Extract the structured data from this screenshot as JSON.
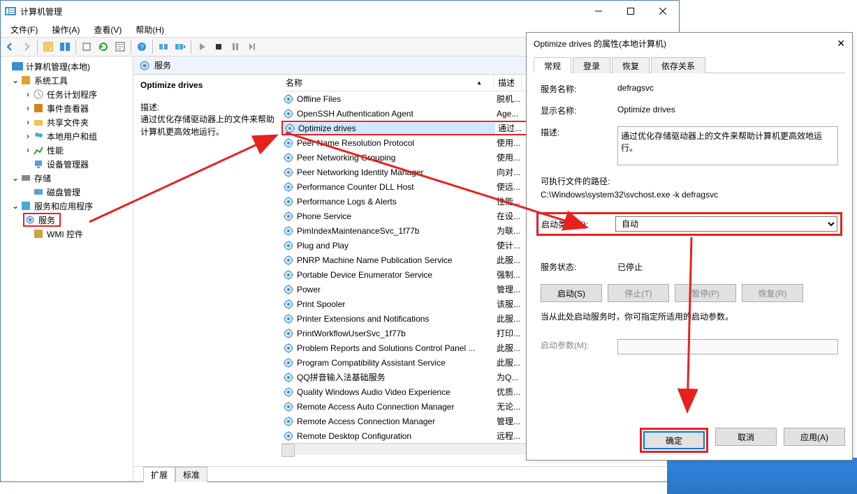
{
  "window": {
    "title": "计算机管理",
    "menu": [
      "文件(F)",
      "操作(A)",
      "查看(V)",
      "帮助(H)"
    ]
  },
  "tree": {
    "root": "计算机管理(本地)",
    "n1": "系统工具",
    "n1a": "任务计划程序",
    "n1b": "事件查看器",
    "n1c": "共享文件夹",
    "n1d": "本地用户和组",
    "n1e": "性能",
    "n1f": "设备管理器",
    "n2": "存储",
    "n2a": "磁盘管理",
    "n3": "服务和应用程序",
    "n3a": "服务",
    "n3b": "WMI 控件"
  },
  "services_pane": {
    "header": "服务",
    "selected_name": "Optimize drives",
    "desc_label": "描述:",
    "desc_text": "通过优化存储驱动器上的文件来帮助计算机更高效地运行。",
    "col_name": "名称",
    "col_desc": "描述",
    "tab_ext": "扩展",
    "tab_std": "标准"
  },
  "rows": [
    {
      "name": "Offline Files",
      "desc": "脱机..."
    },
    {
      "name": "OpenSSH Authentication Agent",
      "desc": "Age..."
    },
    {
      "name": "Optimize drives",
      "desc": "通过...",
      "selected": true
    },
    {
      "name": "Peer Name Resolution Protocol",
      "desc": "使用..."
    },
    {
      "name": "Peer Networking Grouping",
      "desc": "使用..."
    },
    {
      "name": "Peer Networking Identity Manager",
      "desc": "向对..."
    },
    {
      "name": "Performance Counter DLL Host",
      "desc": "使远..."
    },
    {
      "name": "Performance Logs & Alerts",
      "desc": "性能..."
    },
    {
      "name": "Phone Service",
      "desc": "在设..."
    },
    {
      "name": "PimIndexMaintenanceSvc_1f77b",
      "desc": "为联..."
    },
    {
      "name": "Plug and Play",
      "desc": "使计..."
    },
    {
      "name": "PNRP Machine Name Publication Service",
      "desc": "此服..."
    },
    {
      "name": "Portable Device Enumerator Service",
      "desc": "强制..."
    },
    {
      "name": "Power",
      "desc": "管理..."
    },
    {
      "name": "Print Spooler",
      "desc": "该服..."
    },
    {
      "name": "Printer Extensions and Notifications",
      "desc": "此服..."
    },
    {
      "name": "PrintWorkflowUserSvc_1f77b",
      "desc": "打印..."
    },
    {
      "name": "Problem Reports and Solutions Control Panel ...",
      "desc": "此服..."
    },
    {
      "name": "Program Compatibility Assistant Service",
      "desc": "此服..."
    },
    {
      "name": "QQ拼音输入法基础服务",
      "desc": "为Q..."
    },
    {
      "name": "Quality Windows Audio Video Experience",
      "desc": "优质..."
    },
    {
      "name": "Remote Access Auto Connection Manager",
      "desc": "无论..."
    },
    {
      "name": "Remote Access Connection Manager",
      "desc": "管理..."
    },
    {
      "name": "Remote Desktop Configuration",
      "desc": "远程..."
    }
  ],
  "dialog": {
    "title": "Optimize drives 的属性(本地计算机)",
    "tabs": {
      "t1": "常规",
      "t2": "登录",
      "t3": "恢复",
      "t4": "依存关系"
    },
    "svc_name_label": "服务名称:",
    "svc_name": "defragsvc",
    "disp_name_label": "显示名称:",
    "disp_name": "Optimize drives",
    "desc_label": "描述:",
    "desc": "通过优化存储驱动器上的文件来帮助计算机更高效地运行。",
    "exe_label": "可执行文件的路径:",
    "exe": "C:\\Windows\\system32\\svchost.exe -k defragsvc",
    "startup_label": "启动类型(E):",
    "startup_value": "自动",
    "status_label": "服务状态:",
    "status": "已停止",
    "btn_start": "启动(S)",
    "btn_stop": "停止(T)",
    "btn_pause": "暂停(P)",
    "btn_resume": "恢复(R)",
    "hint": "当从此处启动服务时，你可指定所适用的启动参数。",
    "startparams_label": "启动参数(M):",
    "ok": "确定",
    "cancel": "取消",
    "apply": "应用(A)"
  }
}
